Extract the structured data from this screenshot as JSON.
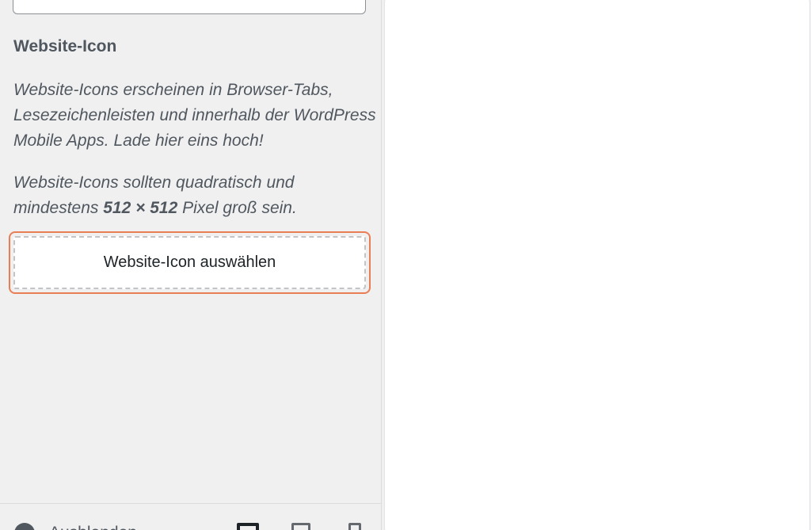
{
  "section": {
    "title": "Website-Icon",
    "description_1": "Website-Icons erscheinen in Browser-Tabs, Lesezeichenleisten und innerhalb der WordPress Mobile Apps. Lade hier eins hoch!",
    "description_2_prefix": "Website-Icons sollten quadratisch und mindestens ",
    "description_2_size": "512 × 512",
    "description_2_suffix": " Pixel groß sein.",
    "select_button_label": "Website-Icon auswählen"
  },
  "footer": {
    "collapse_label": "Ausblenden",
    "collapse_icon": "chevron-circle-icon",
    "devices": [
      "desktop-icon",
      "tablet-icon",
      "mobile-icon"
    ]
  },
  "colors": {
    "focus_outline": "#e97e54",
    "panel_bg": "#f0f0f1",
    "text": "#50575e"
  }
}
